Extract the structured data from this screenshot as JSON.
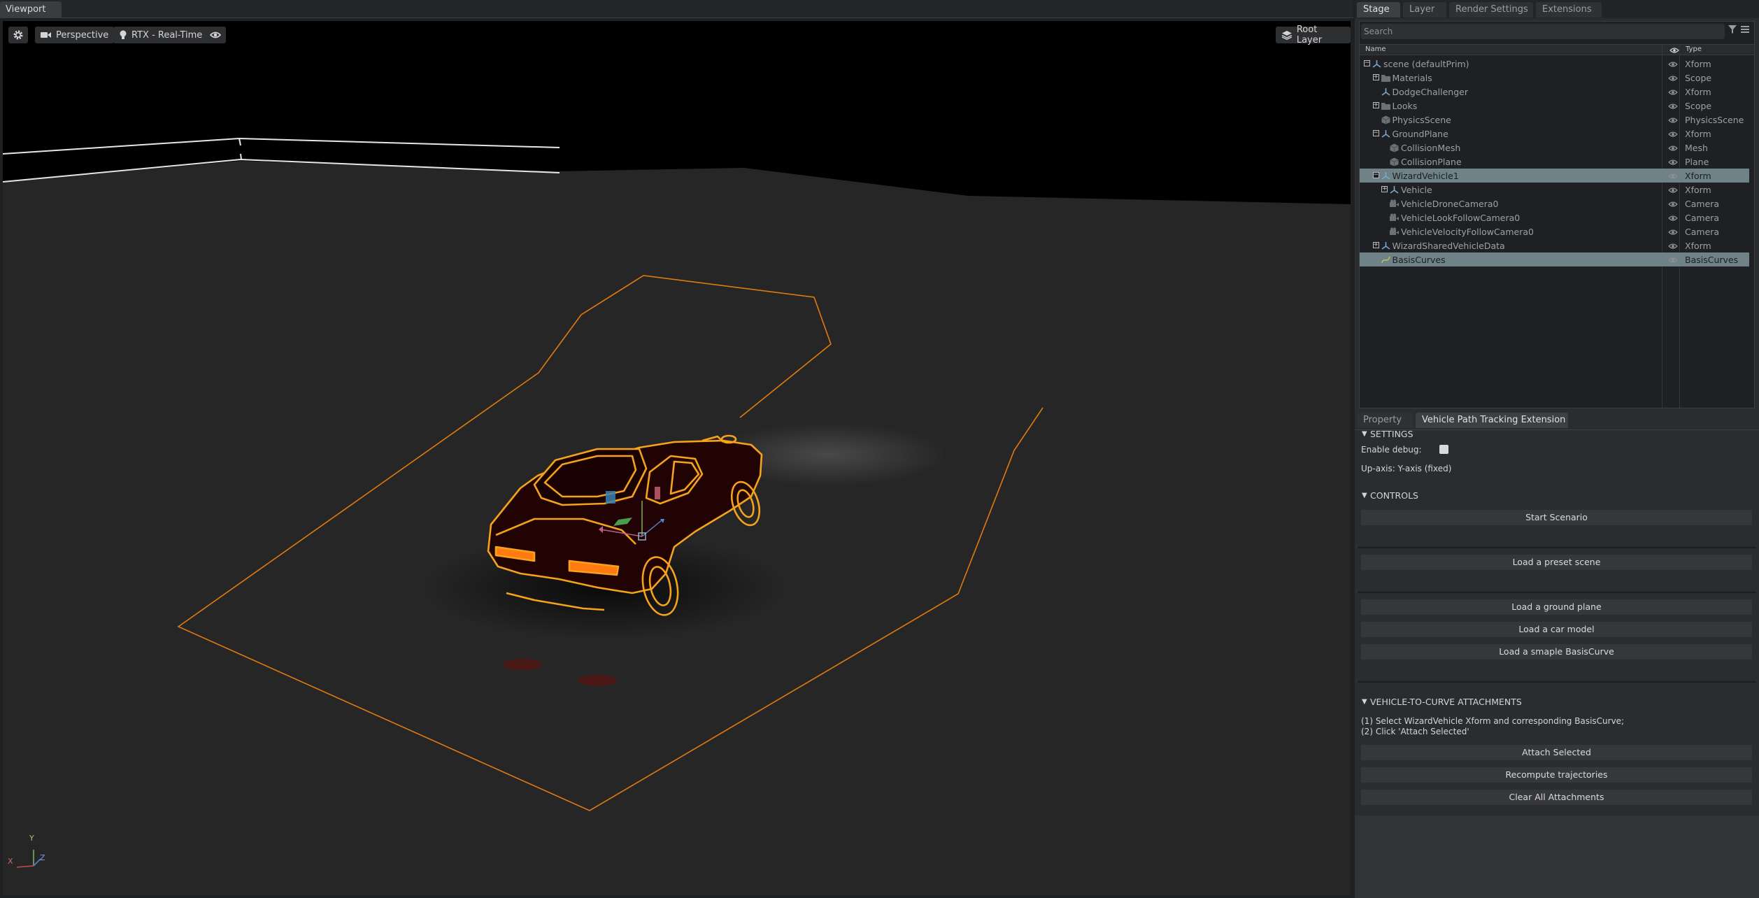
{
  "viewport": {
    "tab": "Viewport",
    "toolbar": {
      "camera": "Perspective",
      "render_mode": "RTX - Real-Time",
      "layer": "Root Layer"
    },
    "axis_labels": {
      "x": "X",
      "y": "Y",
      "z": "Z"
    }
  },
  "right_panel": {
    "top_tabs": [
      "Stage",
      "Layer",
      "Render Settings",
      "Extensions"
    ],
    "active_top_tab": "Stage",
    "search_placeholder": "Search",
    "columns": {
      "name": "Name",
      "type": "Type"
    },
    "tree": [
      {
        "name": "scene (defaultPrim)",
        "type": "Xform",
        "depth": 0,
        "expander": "−",
        "icon": "xform-icon",
        "selected": false
      },
      {
        "name": "Materials",
        "type": "Scope",
        "depth": 1,
        "expander": "+",
        "icon": "folder-icon",
        "selected": false
      },
      {
        "name": "DodgeChallenger",
        "type": "Xform",
        "depth": 1,
        "expander": "",
        "icon": "xform-icon",
        "selected": false
      },
      {
        "name": "Looks",
        "type": "Scope",
        "depth": 1,
        "expander": "+",
        "icon": "folder-icon",
        "selected": false
      },
      {
        "name": "PhysicsScene",
        "type": "PhysicsScene",
        "depth": 1,
        "expander": "",
        "icon": "cube-icon",
        "selected": false
      },
      {
        "name": "GroundPlane",
        "type": "Xform",
        "depth": 1,
        "expander": "−",
        "icon": "xform-icon",
        "selected": false
      },
      {
        "name": "CollisionMesh",
        "type": "Mesh",
        "depth": 2,
        "expander": "",
        "icon": "cube-icon",
        "selected": false
      },
      {
        "name": "CollisionPlane",
        "type": "Plane",
        "depth": 2,
        "expander": "",
        "icon": "cube-icon",
        "selected": false
      },
      {
        "name": "WizardVehicle1",
        "type": "Xform",
        "depth": 1,
        "expander": "−",
        "icon": "xform-icon",
        "selected": true
      },
      {
        "name": "Vehicle",
        "type": "Xform",
        "depth": 2,
        "expander": "+",
        "icon": "xform-icon",
        "selected": false
      },
      {
        "name": "VehicleDroneCamera0",
        "type": "Camera",
        "depth": 2,
        "expander": "",
        "icon": "camera-icon",
        "selected": false
      },
      {
        "name": "VehicleLookFollowCamera0",
        "type": "Camera",
        "depth": 2,
        "expander": "",
        "icon": "camera-icon",
        "selected": false
      },
      {
        "name": "VehicleVelocityFollowCamera0",
        "type": "Camera",
        "depth": 2,
        "expander": "",
        "icon": "camera-icon",
        "selected": false
      },
      {
        "name": "WizardSharedVehicleData",
        "type": "Xform",
        "depth": 1,
        "expander": "+",
        "icon": "xform-icon",
        "selected": false
      },
      {
        "name": "BasisCurves",
        "type": "BasisCurves",
        "depth": 1,
        "expander": "",
        "icon": "curve-icon",
        "selected": true
      }
    ],
    "bottom_tabs": [
      "Property",
      "Vehicle Path Tracking Extension"
    ],
    "active_bottom_tab": "Vehicle Path Tracking Extension",
    "extension": {
      "settings_header": "SETTINGS",
      "enable_debug_label": "Enable debug:",
      "up_axis_label": "Up-axis: Y-axis (fixed)",
      "controls_header": "CONTROLS",
      "start_button": "Start Scenario",
      "preset_button": "Load a preset scene",
      "ground_button": "Load a ground plane",
      "car_button": "Load a car model",
      "curve_button": "Load a smaple BasisCurve",
      "attach_header": "VEHICLE-TO-CURVE ATTACHMENTS",
      "instruction_1": "(1) Select WizardVehicle Xform and corresponding BasisCurve;",
      "instruction_2": "(2) Click 'Attach Selected'",
      "attach_button": "Attach Selected",
      "recompute_button": "Recompute trajectories",
      "clear_button": "Clear All Attachments"
    }
  },
  "colors": {
    "path_orange": "#e07a10",
    "car_outline": "#f5a21c",
    "selection_row": "#6f8287"
  }
}
